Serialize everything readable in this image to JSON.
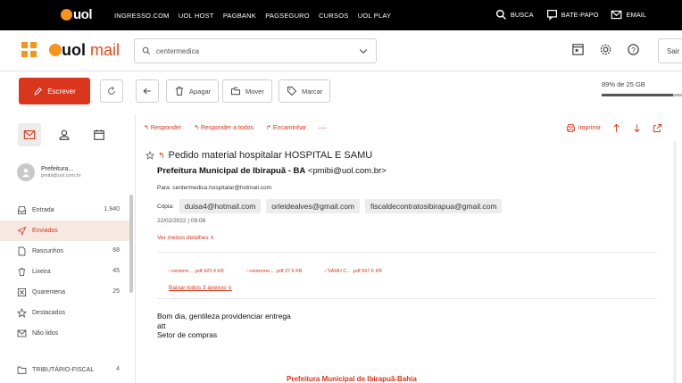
{
  "topbar": {
    "logo": "uol",
    "links": [
      "INGRESSO.COM",
      "UOL HOST",
      "PAGBANK",
      "PAGSEGURO",
      "CURSOS",
      "UOL PLAY"
    ],
    "busca": "BUSCA",
    "batepapo": "BATE-PAPO",
    "email": "EMAIL"
  },
  "header": {
    "logo_uol": "uol",
    "logo_mail": "mail",
    "search_value": "centermedica",
    "sair": "Sair"
  },
  "toolbar": {
    "compose": "Escrever",
    "delete": "Apagar",
    "move": "Mover",
    "mark": "Marcar",
    "quota_text": "89% de 25 GB",
    "quota_percent": 89
  },
  "account": {
    "name": "Prefeitura...",
    "email": "pmibi@uol.com.br"
  },
  "folders": [
    {
      "label": "Entrada",
      "count": "1.940",
      "icon": "inbox-icon"
    },
    {
      "label": "Enviados",
      "count": "",
      "icon": "send-icon"
    },
    {
      "label": "Rascunhos",
      "count": "68",
      "icon": "draft-icon"
    },
    {
      "label": "Lixeira",
      "count": "45",
      "icon": "trash-icon"
    },
    {
      "label": "Quarentena",
      "count": "25",
      "icon": "quarantine-icon"
    },
    {
      "label": "Destacados",
      "count": "",
      "icon": "star-icon"
    },
    {
      "label": "Não lidos",
      "count": "",
      "icon": "unread-icon"
    },
    {
      "label": "TRIBUTÁRIO-FISCAL",
      "count": "4",
      "icon": "folder-icon"
    }
  ],
  "message": {
    "actions": {
      "reply": "Responder",
      "reply_all": "Responder a todos",
      "forward": "Encaminhar",
      "more": "...",
      "print": "Imprimir"
    },
    "subject": "Pedido material hospitalar HOSPITAL E SAMU",
    "from_name": "Prefeitura Municipal de Ibirapuã - BA",
    "from_email": "<pmibi@uol.com.br>",
    "to_label": "Para:",
    "to": "centermedica.hospitalar@hotmail.com",
    "cc_label": "Cópia:",
    "cc": [
      "duisa4@hotmail.com",
      "orleidealves@gmail.com",
      "fiscaldecontratosibirapua@gmail.com"
    ],
    "date": "22/02/2022 | 09:08",
    "less_details": "Ver menos detalhes",
    "attachments": [
      "centerm... .pdf  423.4 KB",
      "centerme... .pdf  37.6 KB",
      "SAMU C... .pdf  567.6 KB"
    ],
    "download_all": "Baixar todos 3 anexos",
    "body_lines": [
      "Bom dia, gentileza providenciar entrega",
      "att",
      "Setor de compras"
    ],
    "footer": "Prefeitura Municipal de Ibirapuã-Bahia"
  }
}
